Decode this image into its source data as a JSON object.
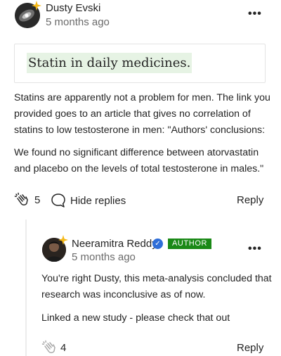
{
  "comment": {
    "author": "Dusty Evski",
    "time": "5 months ago",
    "more": "•••",
    "quote": "Statin in daily medicines.",
    "lines_p1": [
      "Statins are apparently not a problem for men. The link you",
      "provided goes to an article that gives no correlation of",
      "statins to low testosterone in men: \"Authors' conclusions:"
    ],
    "lines_p2": [
      "We found no significant difference between atorvastatin",
      "and placebo on the levels of total testosterone in males.\""
    ],
    "claps": "5",
    "hide_replies": "Hide replies",
    "reply": "Reply"
  },
  "reply_comment": {
    "author": "Neeramitra Reddy",
    "badge": "AUTHOR",
    "time": "5 months ago",
    "more": "•••",
    "lines_p1": [
      "You're right Dusty, this meta-analysis concluded that",
      "research was inconclusive as of now."
    ],
    "lines_p2": [
      "Linked a new study - please check that out"
    ],
    "claps": "4",
    "reply": "Reply"
  },
  "colors": {
    "highlight": "#e6f3e4",
    "author_badge": "#1a8917",
    "verified": "#2f6ed8",
    "muted": "#6b6b6b"
  }
}
